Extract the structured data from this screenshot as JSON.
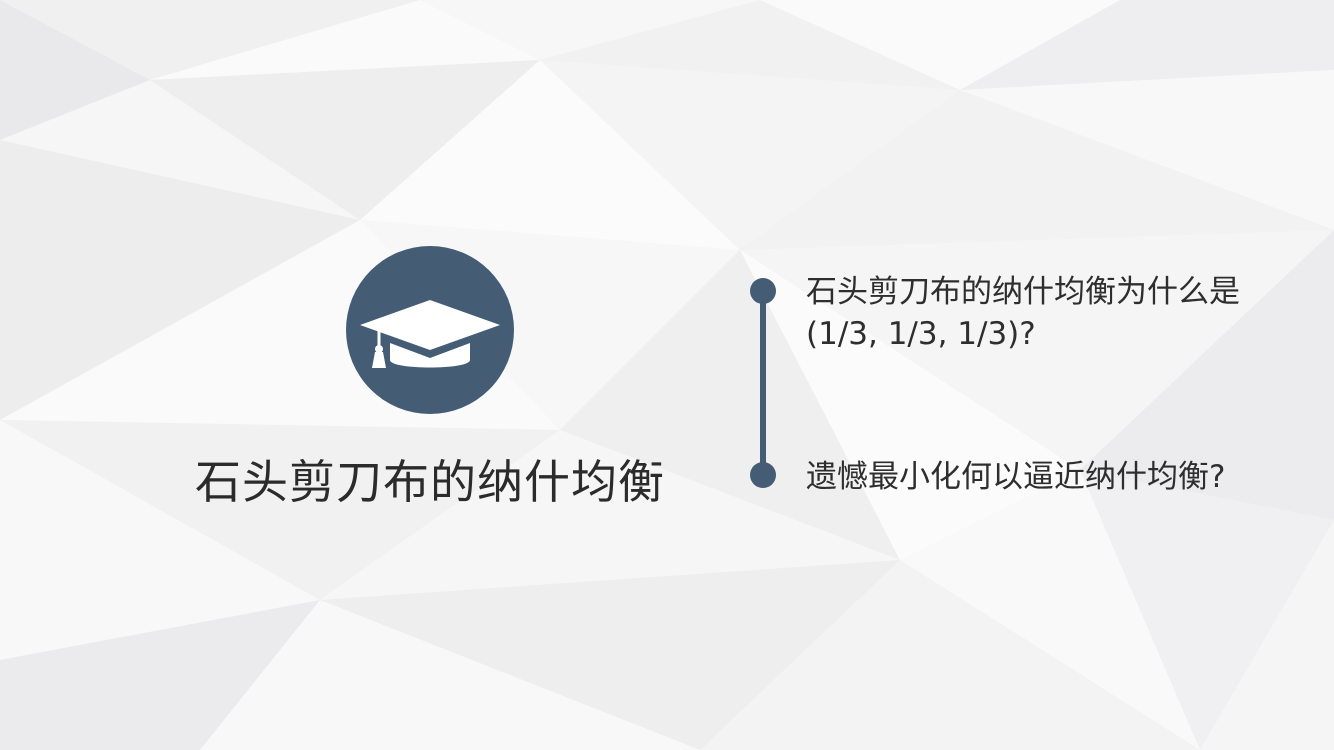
{
  "slide": {
    "title": "石头剪刀布的纳什均衡",
    "icon": "graduation-cap-icon",
    "accent_color": "#445c74",
    "items": [
      {
        "line1": "石头剪刀布的纳什均衡为什么是",
        "line2": "(1/3, 1/3, 1/3)?"
      },
      {
        "line1": "遗憾最小化何以逼近纳什均衡?"
      }
    ]
  }
}
